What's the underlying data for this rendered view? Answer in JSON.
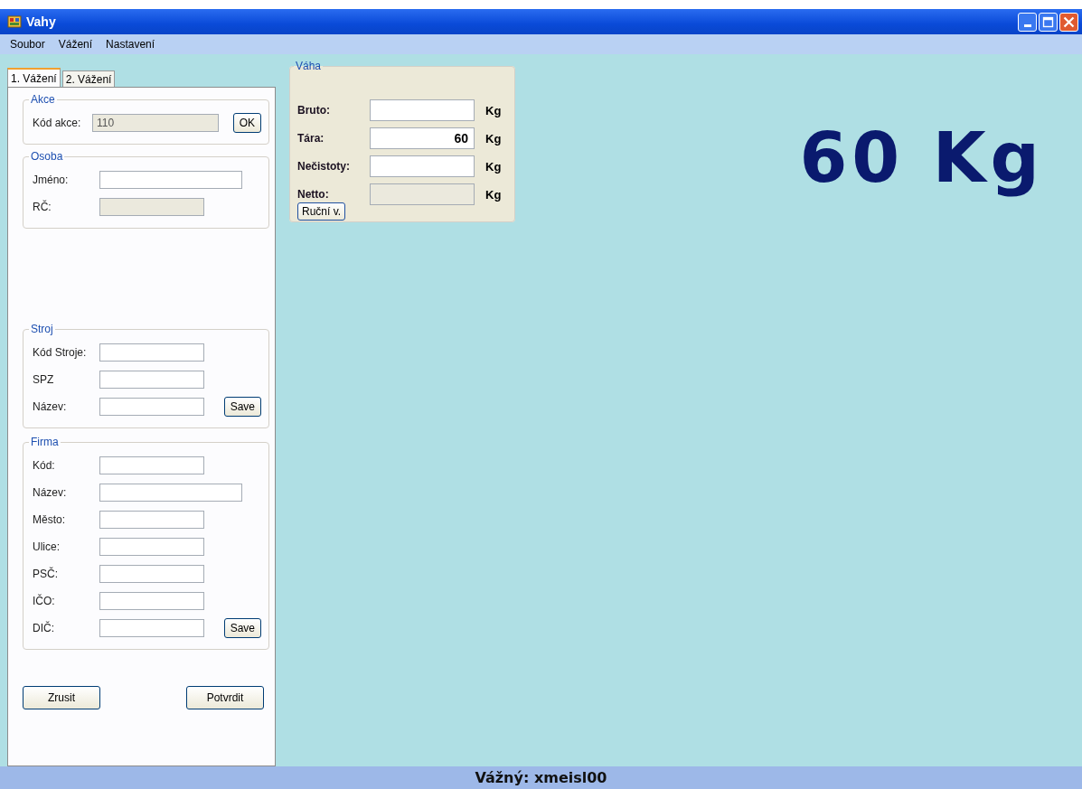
{
  "window": {
    "title": "Vahy"
  },
  "menu": [
    "Soubor",
    "Vážení",
    "Nastavení"
  ],
  "tabs": [
    {
      "label": "1. Vážení",
      "selected": true
    },
    {
      "label": "2. Vážení",
      "selected": false
    }
  ],
  "groups": [
    {
      "title": "Akce",
      "fields": [
        {
          "label": "Kód akce:",
          "value": "110",
          "disabled": true
        }
      ],
      "button": "OK"
    },
    {
      "title": "Osoba",
      "fields": [
        {
          "label": "Jméno:",
          "disabled": false
        },
        {
          "label": "RČ:",
          "disabled": true
        }
      ]
    },
    {
      "title": "Stroj",
      "fields": [
        {
          "label": "Kód Stroje:",
          "disabled": false
        },
        {
          "label": "SPZ",
          "disabled": false
        },
        {
          "label": "Název:",
          "disabled": false
        }
      ],
      "button": "Save"
    },
    {
      "title": "Firma",
      "fields": [
        {
          "label": "Kód:",
          "disabled": false
        },
        {
          "label": "Název:",
          "disabled": false
        },
        {
          "label": "Město:",
          "disabled": false
        },
        {
          "label": "Ulice:",
          "disabled": false
        },
        {
          "label": "PSČ:",
          "disabled": false
        },
        {
          "label": "IČO:",
          "disabled": false
        },
        {
          "label": "DIČ:",
          "disabled": false
        }
      ],
      "button": "Save"
    }
  ],
  "actions": [
    "Zrusit",
    "Potvrdit"
  ],
  "scale": {
    "title": "Váha",
    "fields": [
      {
        "label": "Bruto:",
        "unit": "Kg",
        "disabled": false
      },
      {
        "label": "Tára:",
        "value": "60",
        "unit": "Kg",
        "disabled": false
      },
      {
        "label": "Nečistoty:",
        "unit": "Kg",
        "disabled": false
      },
      {
        "label": "Netto:",
        "unit": "Kg",
        "disabled": true
      }
    ],
    "button": "Ruční v."
  },
  "display": "60 Kg",
  "status_bar": "Vážný: xmeisl00"
}
